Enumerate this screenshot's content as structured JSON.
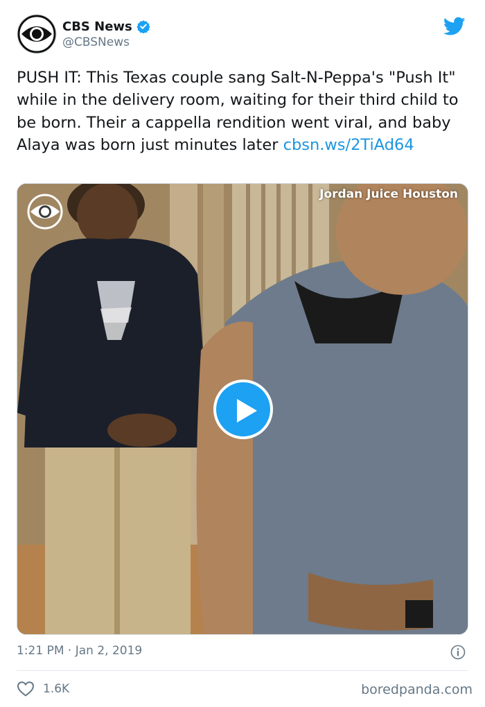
{
  "author": {
    "display_name": "CBS News",
    "handle": "@CBSNews",
    "verified_icon": "verified-badge-icon",
    "avatar_icon": "cbs-eye-logo"
  },
  "platform_icon": "twitter-bird-icon",
  "tweet": {
    "text_before_link": "PUSH IT: This Texas couple sang Salt-N-Peppa's \"Push It\" while in the delivery room, waiting for their third child to be born. Their a cappella rendition went viral, and baby Alaya was born just minutes later ",
    "link_text": "cbsn.ws/2TiAd64"
  },
  "media": {
    "watermark": "Jordan Juice Houston",
    "play_icon": "play-icon"
  },
  "meta": {
    "timestamp": "1:21 PM · Jan 2, 2019",
    "info_icon": "info-icon"
  },
  "engagement": {
    "like_icon": "heart-icon",
    "like_count": "1.6K"
  },
  "source_credit": "boredpanda.com",
  "colors": {
    "link": "#1b95e0",
    "twitter_blue": "#1da1f2",
    "secondary_text": "#657786"
  }
}
